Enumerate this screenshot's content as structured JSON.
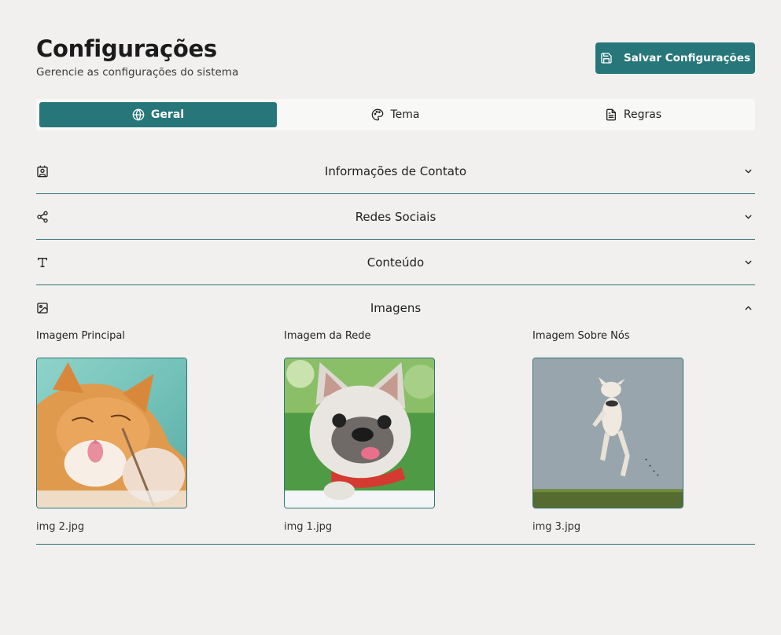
{
  "header": {
    "title": "Configurações",
    "subtitle": "Gerencie as configurações do sistema",
    "save_label": "Salvar Configurações"
  },
  "tabs": [
    {
      "label": "Geral",
      "icon": "globe-icon",
      "active": true
    },
    {
      "label": "Tema",
      "icon": "palette-icon",
      "active": false
    },
    {
      "label": "Regras",
      "icon": "document-icon",
      "active": false
    }
  ],
  "sections": [
    {
      "title": "Informações de Contato",
      "icon": "contact-card-icon",
      "expanded": false
    },
    {
      "title": "Redes Sociais",
      "icon": "share-icon",
      "expanded": false
    },
    {
      "title": "Conteúdo",
      "icon": "type-icon",
      "expanded": false
    },
    {
      "title": "Imagens",
      "icon": "image-icon",
      "expanded": true
    }
  ],
  "images": [
    {
      "label": "Imagem Principal",
      "file": "img 2.jpg",
      "subject": "orange cat"
    },
    {
      "label": "Imagem da Rede",
      "file": "img 1.jpg",
      "subject": "french bulldog"
    },
    {
      "label": "Imagem Sobre Nós",
      "file": "img 3.jpg",
      "subject": "jumping dog"
    }
  ],
  "colors": {
    "accent": "#27777a",
    "background": "#f1f0ef",
    "divider": "#2e7477"
  }
}
